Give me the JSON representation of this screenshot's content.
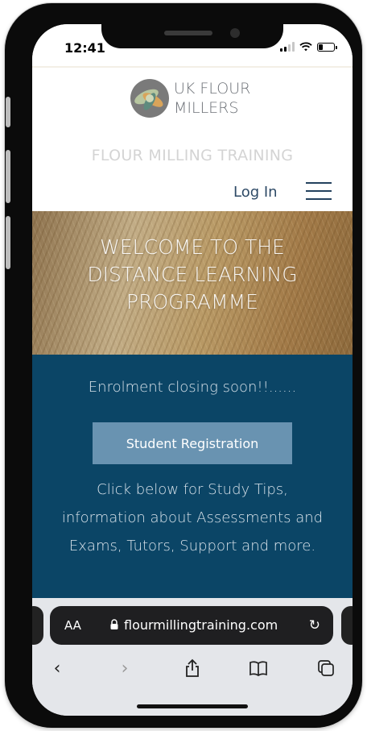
{
  "status_bar": {
    "time": "12:41"
  },
  "header": {
    "logo_line1": "UK FLOUR",
    "logo_line2": "MILLERS",
    "site_title": "FLOUR MILLING TRAINING",
    "login_label": "Log In"
  },
  "hero": {
    "line1": "WELCOME TO THE",
    "line2": "DISTANCE LEARNING",
    "line3": "PROGRAMME"
  },
  "main": {
    "enrolment_notice": "Enrolment closing soon!!......",
    "registration_button": "Student Registration",
    "info_text": "Click below for Study Tips, information about Assessments and Exams, Tutors, Support and more."
  },
  "browser": {
    "text_size_label": "AA",
    "url": "flourmillingtraining.com"
  },
  "colors": {
    "accent_blue": "#0b4566",
    "button_blue": "#6993b1",
    "nav_text": "#2e4a66"
  },
  "icons": [
    "signal-icon",
    "wifi-icon",
    "battery-icon",
    "menu-icon",
    "lock-icon",
    "reload-icon",
    "back-icon",
    "forward-icon",
    "share-icon",
    "bookmarks-icon",
    "tabs-icon"
  ]
}
